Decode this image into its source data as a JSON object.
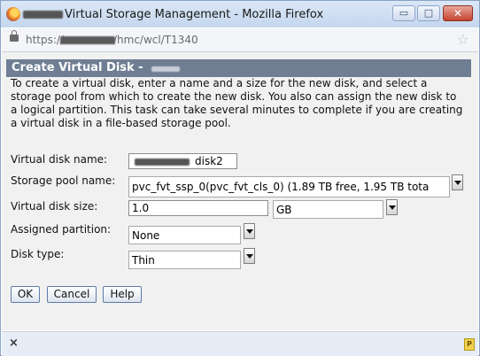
{
  "window": {
    "title": "Virtual Storage Management - Mozilla Firefox",
    "minimize": "▭",
    "maximize": "□",
    "close": "✕"
  },
  "urlbar": {
    "prefix": "https://",
    "suffix": "/hmc/wcl/T1340",
    "star": "☆"
  },
  "dialog": {
    "title": "Create Virtual Disk -",
    "description": "To create a virtual disk, enter a name and a size for the new disk, and select a storage pool from which to create the new disk. You also can assign the new disk to a logical partition. This task can take several minutes to complete if you are creating a virtual disk in a file-based storage pool."
  },
  "form": {
    "disk_name_label": "Virtual disk name:",
    "disk_name_value": "disk2",
    "storage_pool_label": "Storage pool name:",
    "storage_pool_value": "pvc_fvt_ssp_0(pvc_fvt_cls_0) (1.89 TB free, 1.95 TB tota",
    "disk_size_label": "Virtual disk size:",
    "disk_size_value": "1.0",
    "size_unit": "GB",
    "partition_label": "Assigned partition:",
    "partition_value": "None",
    "disk_type_label": "Disk type:",
    "disk_type_value": "Thin"
  },
  "buttons": {
    "ok": "OK",
    "cancel": "Cancel",
    "help": "Help"
  },
  "statusbar": {
    "close": "×",
    "icon": "P"
  }
}
